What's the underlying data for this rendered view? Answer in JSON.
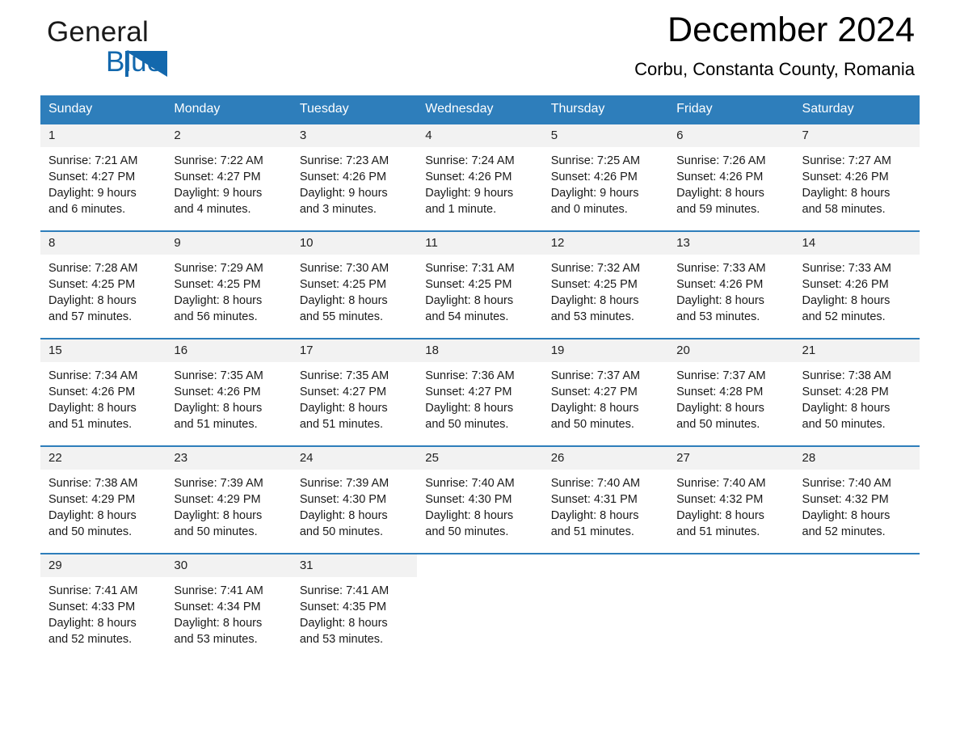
{
  "brand": {
    "word_general": "General",
    "word_blue": "Blue",
    "triangle_color": "#1368ad",
    "accent_color": "#2e7ebb"
  },
  "header": {
    "month_title": "December 2024",
    "location": "Corbu, Constanta County, Romania"
  },
  "weekday_headers": [
    "Sunday",
    "Monday",
    "Tuesday",
    "Wednesday",
    "Thursday",
    "Friday",
    "Saturday"
  ],
  "weeks": [
    [
      {
        "day": "1",
        "sunrise": "Sunrise: 7:21 AM",
        "sunset": "Sunset: 4:27 PM",
        "daylight1": "Daylight: 9 hours",
        "daylight2": "and 6 minutes."
      },
      {
        "day": "2",
        "sunrise": "Sunrise: 7:22 AM",
        "sunset": "Sunset: 4:27 PM",
        "daylight1": "Daylight: 9 hours",
        "daylight2": "and 4 minutes."
      },
      {
        "day": "3",
        "sunrise": "Sunrise: 7:23 AM",
        "sunset": "Sunset: 4:26 PM",
        "daylight1": "Daylight: 9 hours",
        "daylight2": "and 3 minutes."
      },
      {
        "day": "4",
        "sunrise": "Sunrise: 7:24 AM",
        "sunset": "Sunset: 4:26 PM",
        "daylight1": "Daylight: 9 hours",
        "daylight2": "and 1 minute."
      },
      {
        "day": "5",
        "sunrise": "Sunrise: 7:25 AM",
        "sunset": "Sunset: 4:26 PM",
        "daylight1": "Daylight: 9 hours",
        "daylight2": "and 0 minutes."
      },
      {
        "day": "6",
        "sunrise": "Sunrise: 7:26 AM",
        "sunset": "Sunset: 4:26 PM",
        "daylight1": "Daylight: 8 hours",
        "daylight2": "and 59 minutes."
      },
      {
        "day": "7",
        "sunrise": "Sunrise: 7:27 AM",
        "sunset": "Sunset: 4:26 PM",
        "daylight1": "Daylight: 8 hours",
        "daylight2": "and 58 minutes."
      }
    ],
    [
      {
        "day": "8",
        "sunrise": "Sunrise: 7:28 AM",
        "sunset": "Sunset: 4:25 PM",
        "daylight1": "Daylight: 8 hours",
        "daylight2": "and 57 minutes."
      },
      {
        "day": "9",
        "sunrise": "Sunrise: 7:29 AM",
        "sunset": "Sunset: 4:25 PM",
        "daylight1": "Daylight: 8 hours",
        "daylight2": "and 56 minutes."
      },
      {
        "day": "10",
        "sunrise": "Sunrise: 7:30 AM",
        "sunset": "Sunset: 4:25 PM",
        "daylight1": "Daylight: 8 hours",
        "daylight2": "and 55 minutes."
      },
      {
        "day": "11",
        "sunrise": "Sunrise: 7:31 AM",
        "sunset": "Sunset: 4:25 PM",
        "daylight1": "Daylight: 8 hours",
        "daylight2": "and 54 minutes."
      },
      {
        "day": "12",
        "sunrise": "Sunrise: 7:32 AM",
        "sunset": "Sunset: 4:25 PM",
        "daylight1": "Daylight: 8 hours",
        "daylight2": "and 53 minutes."
      },
      {
        "day": "13",
        "sunrise": "Sunrise: 7:33 AM",
        "sunset": "Sunset: 4:26 PM",
        "daylight1": "Daylight: 8 hours",
        "daylight2": "and 53 minutes."
      },
      {
        "day": "14",
        "sunrise": "Sunrise: 7:33 AM",
        "sunset": "Sunset: 4:26 PM",
        "daylight1": "Daylight: 8 hours",
        "daylight2": "and 52 minutes."
      }
    ],
    [
      {
        "day": "15",
        "sunrise": "Sunrise: 7:34 AM",
        "sunset": "Sunset: 4:26 PM",
        "daylight1": "Daylight: 8 hours",
        "daylight2": "and 51 minutes."
      },
      {
        "day": "16",
        "sunrise": "Sunrise: 7:35 AM",
        "sunset": "Sunset: 4:26 PM",
        "daylight1": "Daylight: 8 hours",
        "daylight2": "and 51 minutes."
      },
      {
        "day": "17",
        "sunrise": "Sunrise: 7:35 AM",
        "sunset": "Sunset: 4:27 PM",
        "daylight1": "Daylight: 8 hours",
        "daylight2": "and 51 minutes."
      },
      {
        "day": "18",
        "sunrise": "Sunrise: 7:36 AM",
        "sunset": "Sunset: 4:27 PM",
        "daylight1": "Daylight: 8 hours",
        "daylight2": "and 50 minutes."
      },
      {
        "day": "19",
        "sunrise": "Sunrise: 7:37 AM",
        "sunset": "Sunset: 4:27 PM",
        "daylight1": "Daylight: 8 hours",
        "daylight2": "and 50 minutes."
      },
      {
        "day": "20",
        "sunrise": "Sunrise: 7:37 AM",
        "sunset": "Sunset: 4:28 PM",
        "daylight1": "Daylight: 8 hours",
        "daylight2": "and 50 minutes."
      },
      {
        "day": "21",
        "sunrise": "Sunrise: 7:38 AM",
        "sunset": "Sunset: 4:28 PM",
        "daylight1": "Daylight: 8 hours",
        "daylight2": "and 50 minutes."
      }
    ],
    [
      {
        "day": "22",
        "sunrise": "Sunrise: 7:38 AM",
        "sunset": "Sunset: 4:29 PM",
        "daylight1": "Daylight: 8 hours",
        "daylight2": "and 50 minutes."
      },
      {
        "day": "23",
        "sunrise": "Sunrise: 7:39 AM",
        "sunset": "Sunset: 4:29 PM",
        "daylight1": "Daylight: 8 hours",
        "daylight2": "and 50 minutes."
      },
      {
        "day": "24",
        "sunrise": "Sunrise: 7:39 AM",
        "sunset": "Sunset: 4:30 PM",
        "daylight1": "Daylight: 8 hours",
        "daylight2": "and 50 minutes."
      },
      {
        "day": "25",
        "sunrise": "Sunrise: 7:40 AM",
        "sunset": "Sunset: 4:30 PM",
        "daylight1": "Daylight: 8 hours",
        "daylight2": "and 50 minutes."
      },
      {
        "day": "26",
        "sunrise": "Sunrise: 7:40 AM",
        "sunset": "Sunset: 4:31 PM",
        "daylight1": "Daylight: 8 hours",
        "daylight2": "and 51 minutes."
      },
      {
        "day": "27",
        "sunrise": "Sunrise: 7:40 AM",
        "sunset": "Sunset: 4:32 PM",
        "daylight1": "Daylight: 8 hours",
        "daylight2": "and 51 minutes."
      },
      {
        "day": "28",
        "sunrise": "Sunrise: 7:40 AM",
        "sunset": "Sunset: 4:32 PM",
        "daylight1": "Daylight: 8 hours",
        "daylight2": "and 52 minutes."
      }
    ],
    [
      {
        "day": "29",
        "sunrise": "Sunrise: 7:41 AM",
        "sunset": "Sunset: 4:33 PM",
        "daylight1": "Daylight: 8 hours",
        "daylight2": "and 52 minutes."
      },
      {
        "day": "30",
        "sunrise": "Sunrise: 7:41 AM",
        "sunset": "Sunset: 4:34 PM",
        "daylight1": "Daylight: 8 hours",
        "daylight2": "and 53 minutes."
      },
      {
        "day": "31",
        "sunrise": "Sunrise: 7:41 AM",
        "sunset": "Sunset: 4:35 PM",
        "daylight1": "Daylight: 8 hours",
        "daylight2": "and 53 minutes."
      },
      {
        "day": "",
        "sunrise": "",
        "sunset": "",
        "daylight1": "",
        "daylight2": ""
      },
      {
        "day": "",
        "sunrise": "",
        "sunset": "",
        "daylight1": "",
        "daylight2": ""
      },
      {
        "day": "",
        "sunrise": "",
        "sunset": "",
        "daylight1": "",
        "daylight2": ""
      },
      {
        "day": "",
        "sunrise": "",
        "sunset": "",
        "daylight1": "",
        "daylight2": ""
      }
    ]
  ]
}
